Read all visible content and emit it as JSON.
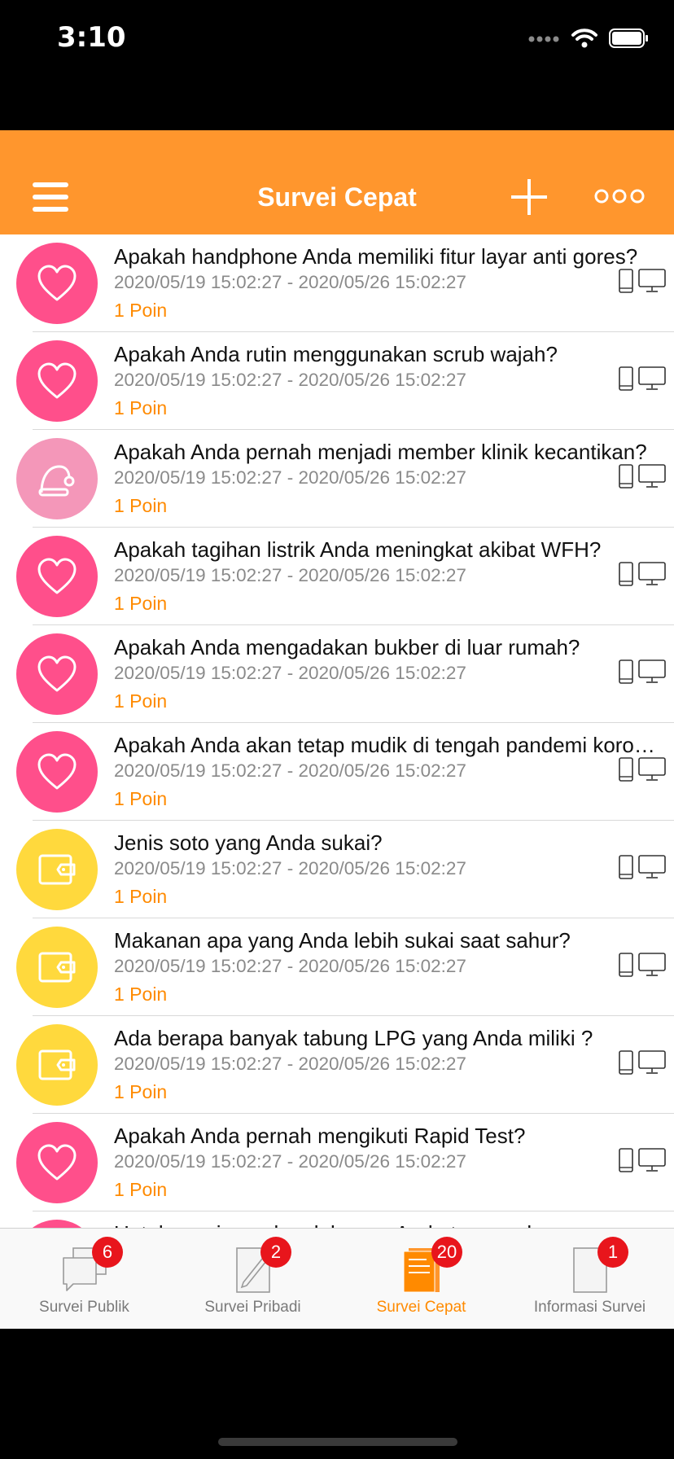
{
  "status": {
    "time": "3:10"
  },
  "header": {
    "title": "Survei Cepat"
  },
  "colors": {
    "accent": "#FF962D",
    "pink": "#FF4F8B",
    "light_pink": "#F497B9",
    "yellow": "#FFD93D",
    "badge": "#E8151C"
  },
  "surveys": [
    {
      "title": "Apakah handphone Anda memiliki fitur layar anti gores?",
      "dates": "2020/05/19 15:02:27 - 2020/05/26 15:02:27",
      "points": "1 Poin",
      "icon": "heart-icon",
      "color": "pink"
    },
    {
      "title": "Apakah Anda rutin menggunakan scrub wajah?",
      "dates": "2020/05/19 15:02:27 - 2020/05/26 15:02:27",
      "points": "1 Poin",
      "icon": "heart-icon",
      "color": "pink"
    },
    {
      "title": "Apakah Anda pernah menjadi member klinik kecantikan?",
      "dates": "2020/05/19 15:02:27 - 2020/05/26 15:02:27",
      "points": "1 Poin",
      "icon": "santa-hat-icon",
      "color": "light_pink"
    },
    {
      "title": "Apakah tagihan listrik Anda meningkat akibat WFH?",
      "dates": "2020/05/19 15:02:27 - 2020/05/26 15:02:27",
      "points": "1 Poin",
      "icon": "heart-icon",
      "color": "pink"
    },
    {
      "title": "Apakah Anda mengadakan bukber di luar rumah?",
      "dates": "2020/05/19 15:02:27 - 2020/05/26 15:02:27",
      "points": "1 Poin",
      "icon": "heart-icon",
      "color": "pink"
    },
    {
      "title": "Apakah Anda akan tetap mudik di tengah pandemi korona?",
      "dates": "2020/05/19 15:02:27 - 2020/05/26 15:02:27",
      "points": "1 Poin",
      "icon": "heart-icon",
      "color": "pink"
    },
    {
      "title": "Jenis soto yang Anda sukai?",
      "dates": "2020/05/19 15:02:27 - 2020/05/26 15:02:27",
      "points": "1 Poin",
      "icon": "wallet-icon",
      "color": "yellow"
    },
    {
      "title": "Makanan apa yang Anda lebih sukai saat sahur?",
      "dates": "2020/05/19 15:02:27 - 2020/05/26 15:02:27",
      "points": "1 Poin",
      "icon": "wallet-icon",
      "color": "yellow"
    },
    {
      "title": "Ada berapa banyak tabung LPG yang Anda miliki ?",
      "dates": "2020/05/19 15:02:27 - 2020/05/26 15:02:27",
      "points": "1 Poin",
      "icon": "wallet-icon",
      "color": "yellow"
    },
    {
      "title": "Apakah Anda pernah mengikuti Rapid Test?",
      "dates": "2020/05/19 15:02:27 - 2020/05/26 15:02:27",
      "points": "1 Poin",
      "icon": "heart-icon",
      "color": "pink"
    },
    {
      "title": "Untuk persiapan kue lebaran, Anda termasuk yang",
      "dates": "",
      "points": "",
      "icon": "heart-icon",
      "color": "pink"
    }
  ],
  "tabs": [
    {
      "label": "Survei Publik",
      "badge": "6",
      "icon": "chat-bubbles-icon"
    },
    {
      "label": "Survei Pribadi",
      "badge": "2",
      "icon": "pencil-note-icon"
    },
    {
      "label": "Survei Cepat",
      "badge": "20",
      "icon": "document-stack-icon",
      "active": true
    },
    {
      "label": "Informasi Survei",
      "badge": "1",
      "icon": "blank-page-icon"
    }
  ]
}
